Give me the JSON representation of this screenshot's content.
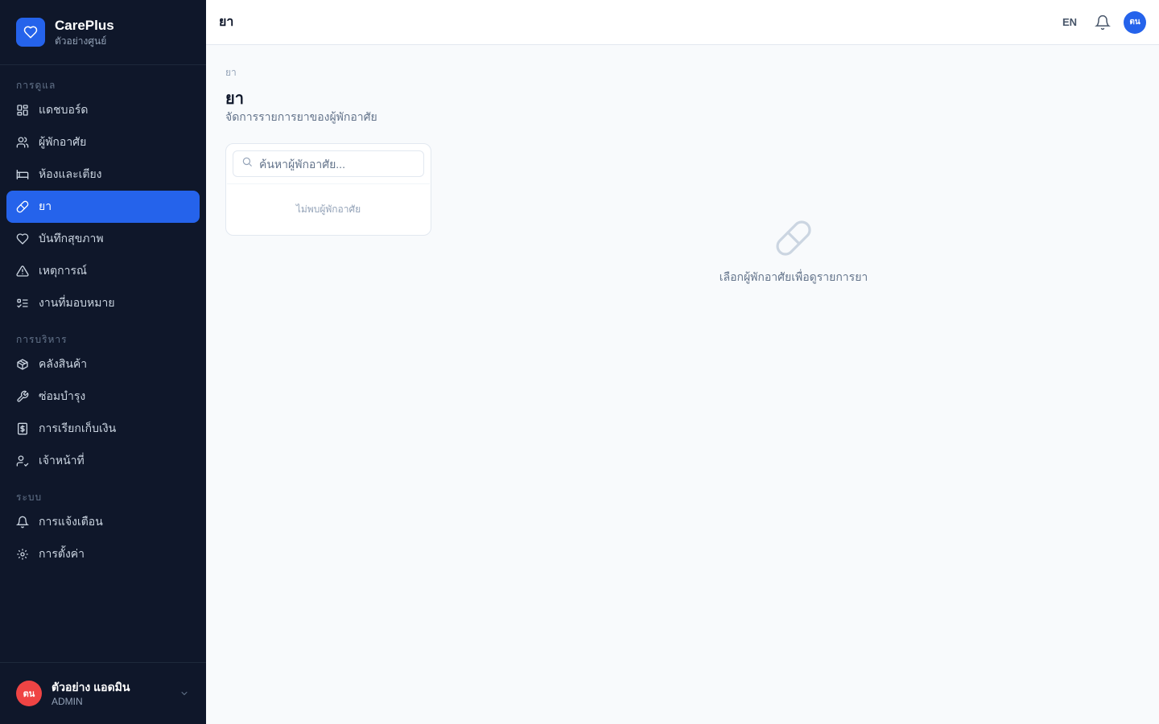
{
  "brand": {
    "name": "CarePlus",
    "subtitle": "ตัวอย่างศูนย์",
    "accent": "#2563eb"
  },
  "sidebar": {
    "sections": [
      {
        "label": "การดูแล"
      },
      {
        "label": "การบริหาร"
      },
      {
        "label": "ระบบ"
      }
    ],
    "items": [
      {
        "label": "แดชบอร์ด",
        "icon": "dashboard-icon"
      },
      {
        "label": "ผู้พักอาศัย",
        "icon": "users-icon"
      },
      {
        "label": "ห้องและเตียง",
        "icon": "bed-icon"
      },
      {
        "label": "ยา",
        "icon": "pill-icon",
        "active": true
      },
      {
        "label": "บันทึกสุขภาพ",
        "icon": "heart-icon"
      },
      {
        "label": "เหตุการณ์",
        "icon": "warning-icon"
      },
      {
        "label": "งานที่มอบหมาย",
        "icon": "task-list-icon"
      },
      {
        "label": "คลังสินค้า",
        "icon": "package-icon"
      },
      {
        "label": "ซ่อมบำรุง",
        "icon": "wrench-icon"
      },
      {
        "label": "การเรียกเก็บเงิน",
        "icon": "billing-icon"
      },
      {
        "label": "เจ้าหน้าที่",
        "icon": "staff-icon"
      },
      {
        "label": "การแจ้งเตือน",
        "icon": "bell-icon"
      },
      {
        "label": "การตั้งค่า",
        "icon": "gear-icon"
      }
    ]
  },
  "user": {
    "initials": "ตน",
    "name": "ตัวอย่าง แอดมิน",
    "role": "ADMIN"
  },
  "topbar": {
    "title": "ยา",
    "lang": "EN",
    "avatar_initials": "ตน"
  },
  "main": {
    "breadcrumb": "ยา",
    "title": "ยา",
    "subtitle": "จัดการรายการยาของผู้พักอาศัย",
    "search": {
      "placeholder": "ค้นหาผู้พักอาศัย..."
    },
    "list_empty": "ไม่พบผู้พักอาศัย",
    "detail_empty": "เลือกผู้พักอาศัยเพื่อดูรายการยา"
  }
}
